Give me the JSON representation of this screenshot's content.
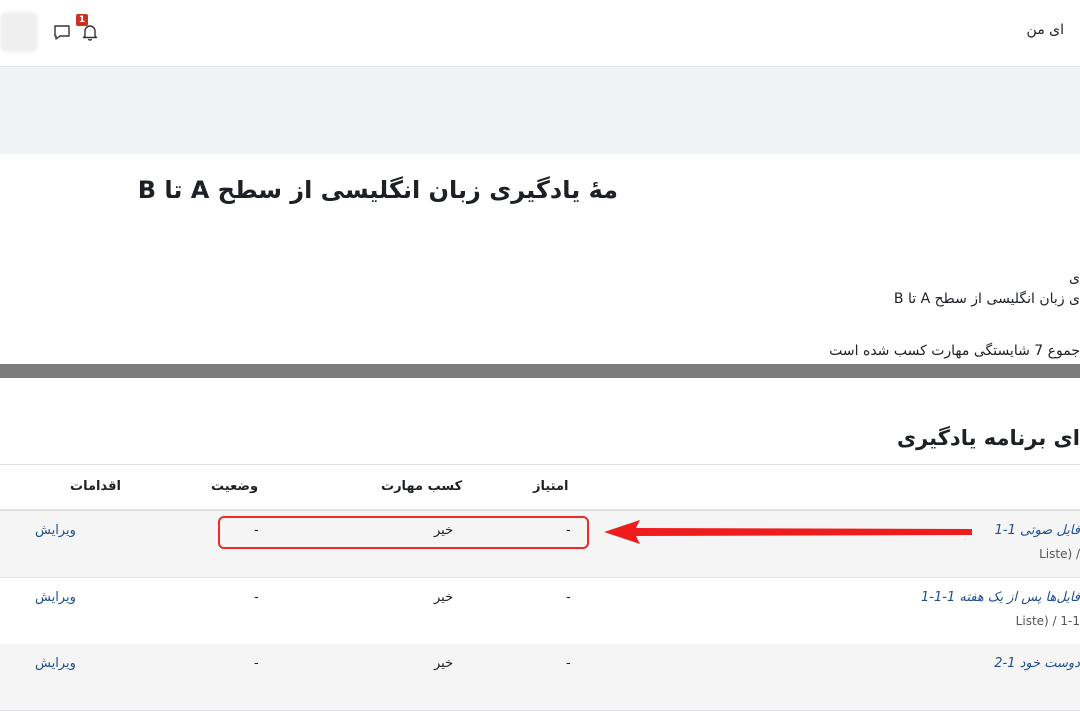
{
  "header": {
    "notification_count": "1",
    "nav_label": "ای من"
  },
  "page": {
    "title": "مهٔ یادگیری زبان انگلیسی از سطح A تا B",
    "subtitle_line1": "ی",
    "subtitle_line2": "ی زبان انگلیسی از سطح A تا B",
    "summary": "جموع 7 شایستگی مهارت کسب شده است"
  },
  "section": {
    "title": "ای برنامه یادگیری"
  },
  "table": {
    "headers": {
      "score": "امتیاز",
      "skill": "کسب مهارت",
      "status": "وضعیت",
      "actions": "اقدامات"
    },
    "rows": [
      {
        "name": "فایل صوتی 1-1",
        "crumb": "/ (Liste",
        "score": "-",
        "skill": "خیر",
        "status": "-",
        "action": "ویرایش"
      },
      {
        "name": "فایل‌ها پس از یک هفته 1-1-1",
        "crumb": "1-1 / (Liste",
        "score": "-",
        "skill": "خیر",
        "status": "-",
        "action": "ویرایش"
      },
      {
        "name": "دوست خود 1-2",
        "crumb": "",
        "score": "-",
        "skill": "خیر",
        "status": "-",
        "action": "ویرایش"
      }
    ]
  },
  "colors": {
    "accent_link": "#1d4f91",
    "highlight": "#ee2a2a",
    "badge": "#ca3120"
  }
}
